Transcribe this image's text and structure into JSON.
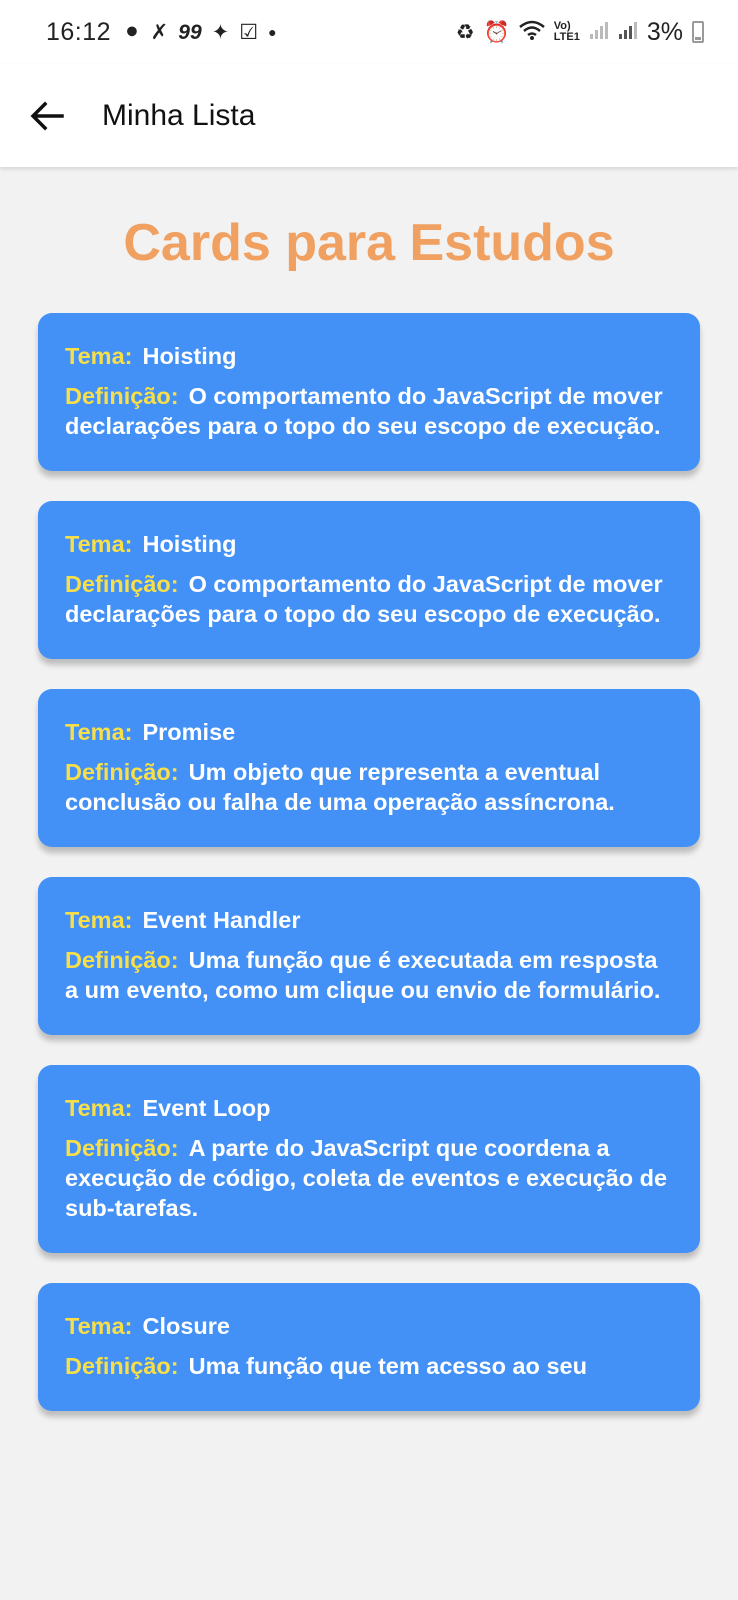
{
  "status_bar": {
    "time": "16:12",
    "notification_count": "99",
    "battery": "3%"
  },
  "appbar": {
    "title": "Minha Lista"
  },
  "page": {
    "heading": "Cards para Estudos",
    "heading_color": "#f0a060",
    "card_color": "#4390f6",
    "label_color": "#f7df4a"
  },
  "labels": {
    "tema": "Tema:",
    "definicao": "Definição:"
  },
  "cards": [
    {
      "tema": "Hoisting",
      "definicao": "O comportamento do JavaScript de mover declarações para o topo do seu escopo de execução."
    },
    {
      "tema": "Hoisting",
      "definicao": "O comportamento do JavaScript de mover declarações para o topo do seu escopo de execução."
    },
    {
      "tema": "Promise",
      "definicao": "Um objeto que representa a eventual conclusão ou falha de uma operação assíncrona."
    },
    {
      "tema": "Event Handler",
      "definicao": "Uma função que é executada em resposta a um evento, como um clique ou envio de formulário."
    },
    {
      "tema": "Event Loop",
      "definicao": "A parte do JavaScript que coordena a execução de código, coleta de eventos e execução de sub-tarefas."
    },
    {
      "tema": "Closure",
      "definicao": "Uma função que tem acesso ao seu"
    }
  ]
}
